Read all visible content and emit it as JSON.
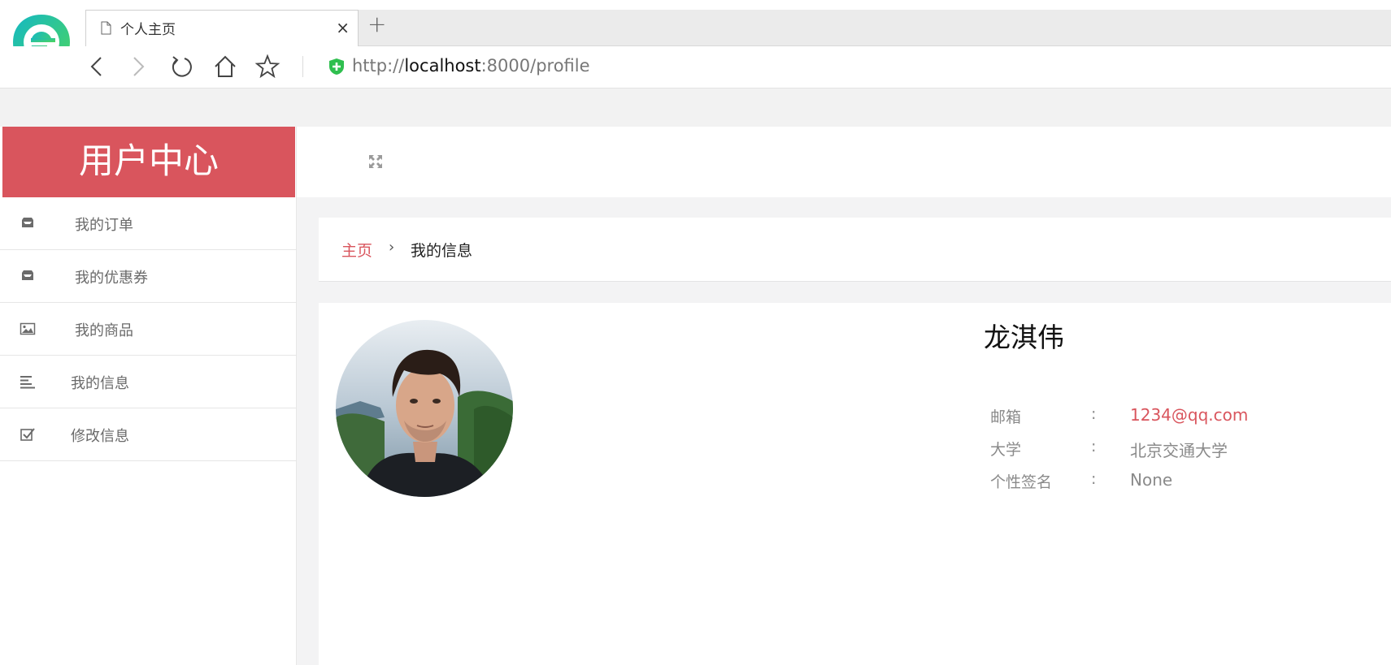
{
  "browser": {
    "tab_title": "个人主页",
    "tab_close": "×",
    "new_tab": "+",
    "url_prefix": "http://",
    "url_host": "localhost",
    "url_rest": ":8000/profile",
    "logo_colors": [
      "#19c2a0",
      "#3fd16f"
    ]
  },
  "sidebar": {
    "brand": "用户中心",
    "brand_color": "#d9555d",
    "items": [
      {
        "label": "我的订单",
        "icon": "inbox-icon"
      },
      {
        "label": "我的优惠券",
        "icon": "inbox-icon"
      },
      {
        "label": "我的商品",
        "icon": "picture-icon"
      },
      {
        "label": "我的信息",
        "icon": "align-left-icon"
      },
      {
        "label": "修改信息",
        "icon": "check-square-icon"
      }
    ]
  },
  "topbar": {
    "expand_icon": "expand-icon"
  },
  "breadcrumb": {
    "home": "主页",
    "separator": "›",
    "current": "我的信息"
  },
  "profile": {
    "name": "龙淇伟",
    "fields": [
      {
        "label": "邮箱",
        "colon": ":",
        "value": "1234@qq.com"
      },
      {
        "label": "大学",
        "colon": ":",
        "value": "北京交通大学"
      },
      {
        "label": "个性签名",
        "colon": ":",
        "value": "None"
      }
    ]
  }
}
